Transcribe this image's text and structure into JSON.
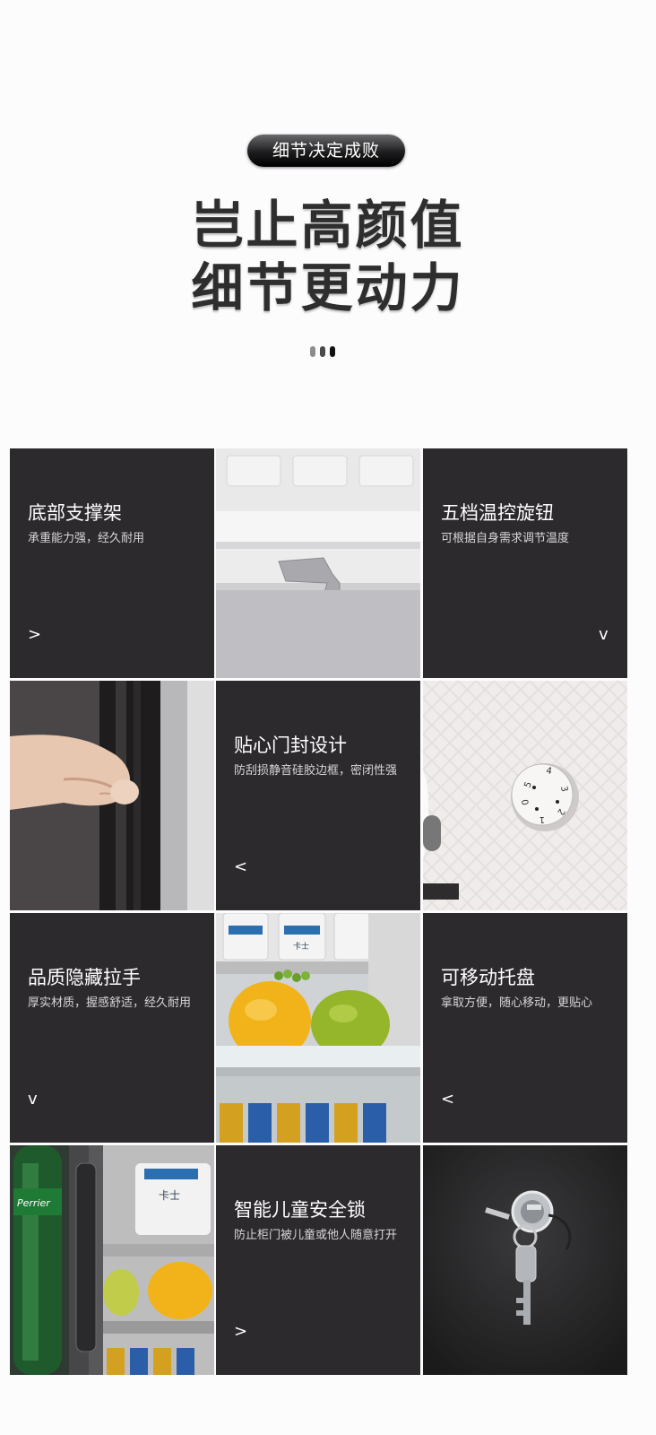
{
  "header": {
    "badge": "细节决定成败",
    "headline_line1": "岂止高颜值",
    "headline_line2": "细节更动力"
  },
  "features": [
    {
      "title": "底部支撑架",
      "desc": "承重能力强，经久耐用",
      "arrow": ">"
    },
    {
      "title": "五档温控旋钮",
      "desc": "可根据自身需求调节温度",
      "arrow": "v"
    },
    {
      "title": "贴心门封设计",
      "desc": "防刮损静音硅胶边框，密闭性强",
      "arrow": "<"
    },
    {
      "title": "品质隐藏拉手",
      "desc": "厚实材质，握感舒适，经久耐用",
      "arrow": "v"
    },
    {
      "title": "可移动托盘",
      "desc": "拿取方便，随心移动，更贴心",
      "arrow": "<"
    },
    {
      "title": "智能儿童安全锁",
      "desc": "防止柜门被儿童或他人随意打开",
      "arrow": ">"
    }
  ],
  "photo_labels": {
    "knob_digits": [
      "5",
      "4",
      "3",
      "2",
      "1",
      "0"
    ],
    "yogurt_brand": "卡士",
    "bottle_brand": "Perrier"
  },
  "colors": {
    "tile_dark": "#2d2a2e",
    "page_bg": "#fdfcfd",
    "headline": "#2e2e2f"
  }
}
